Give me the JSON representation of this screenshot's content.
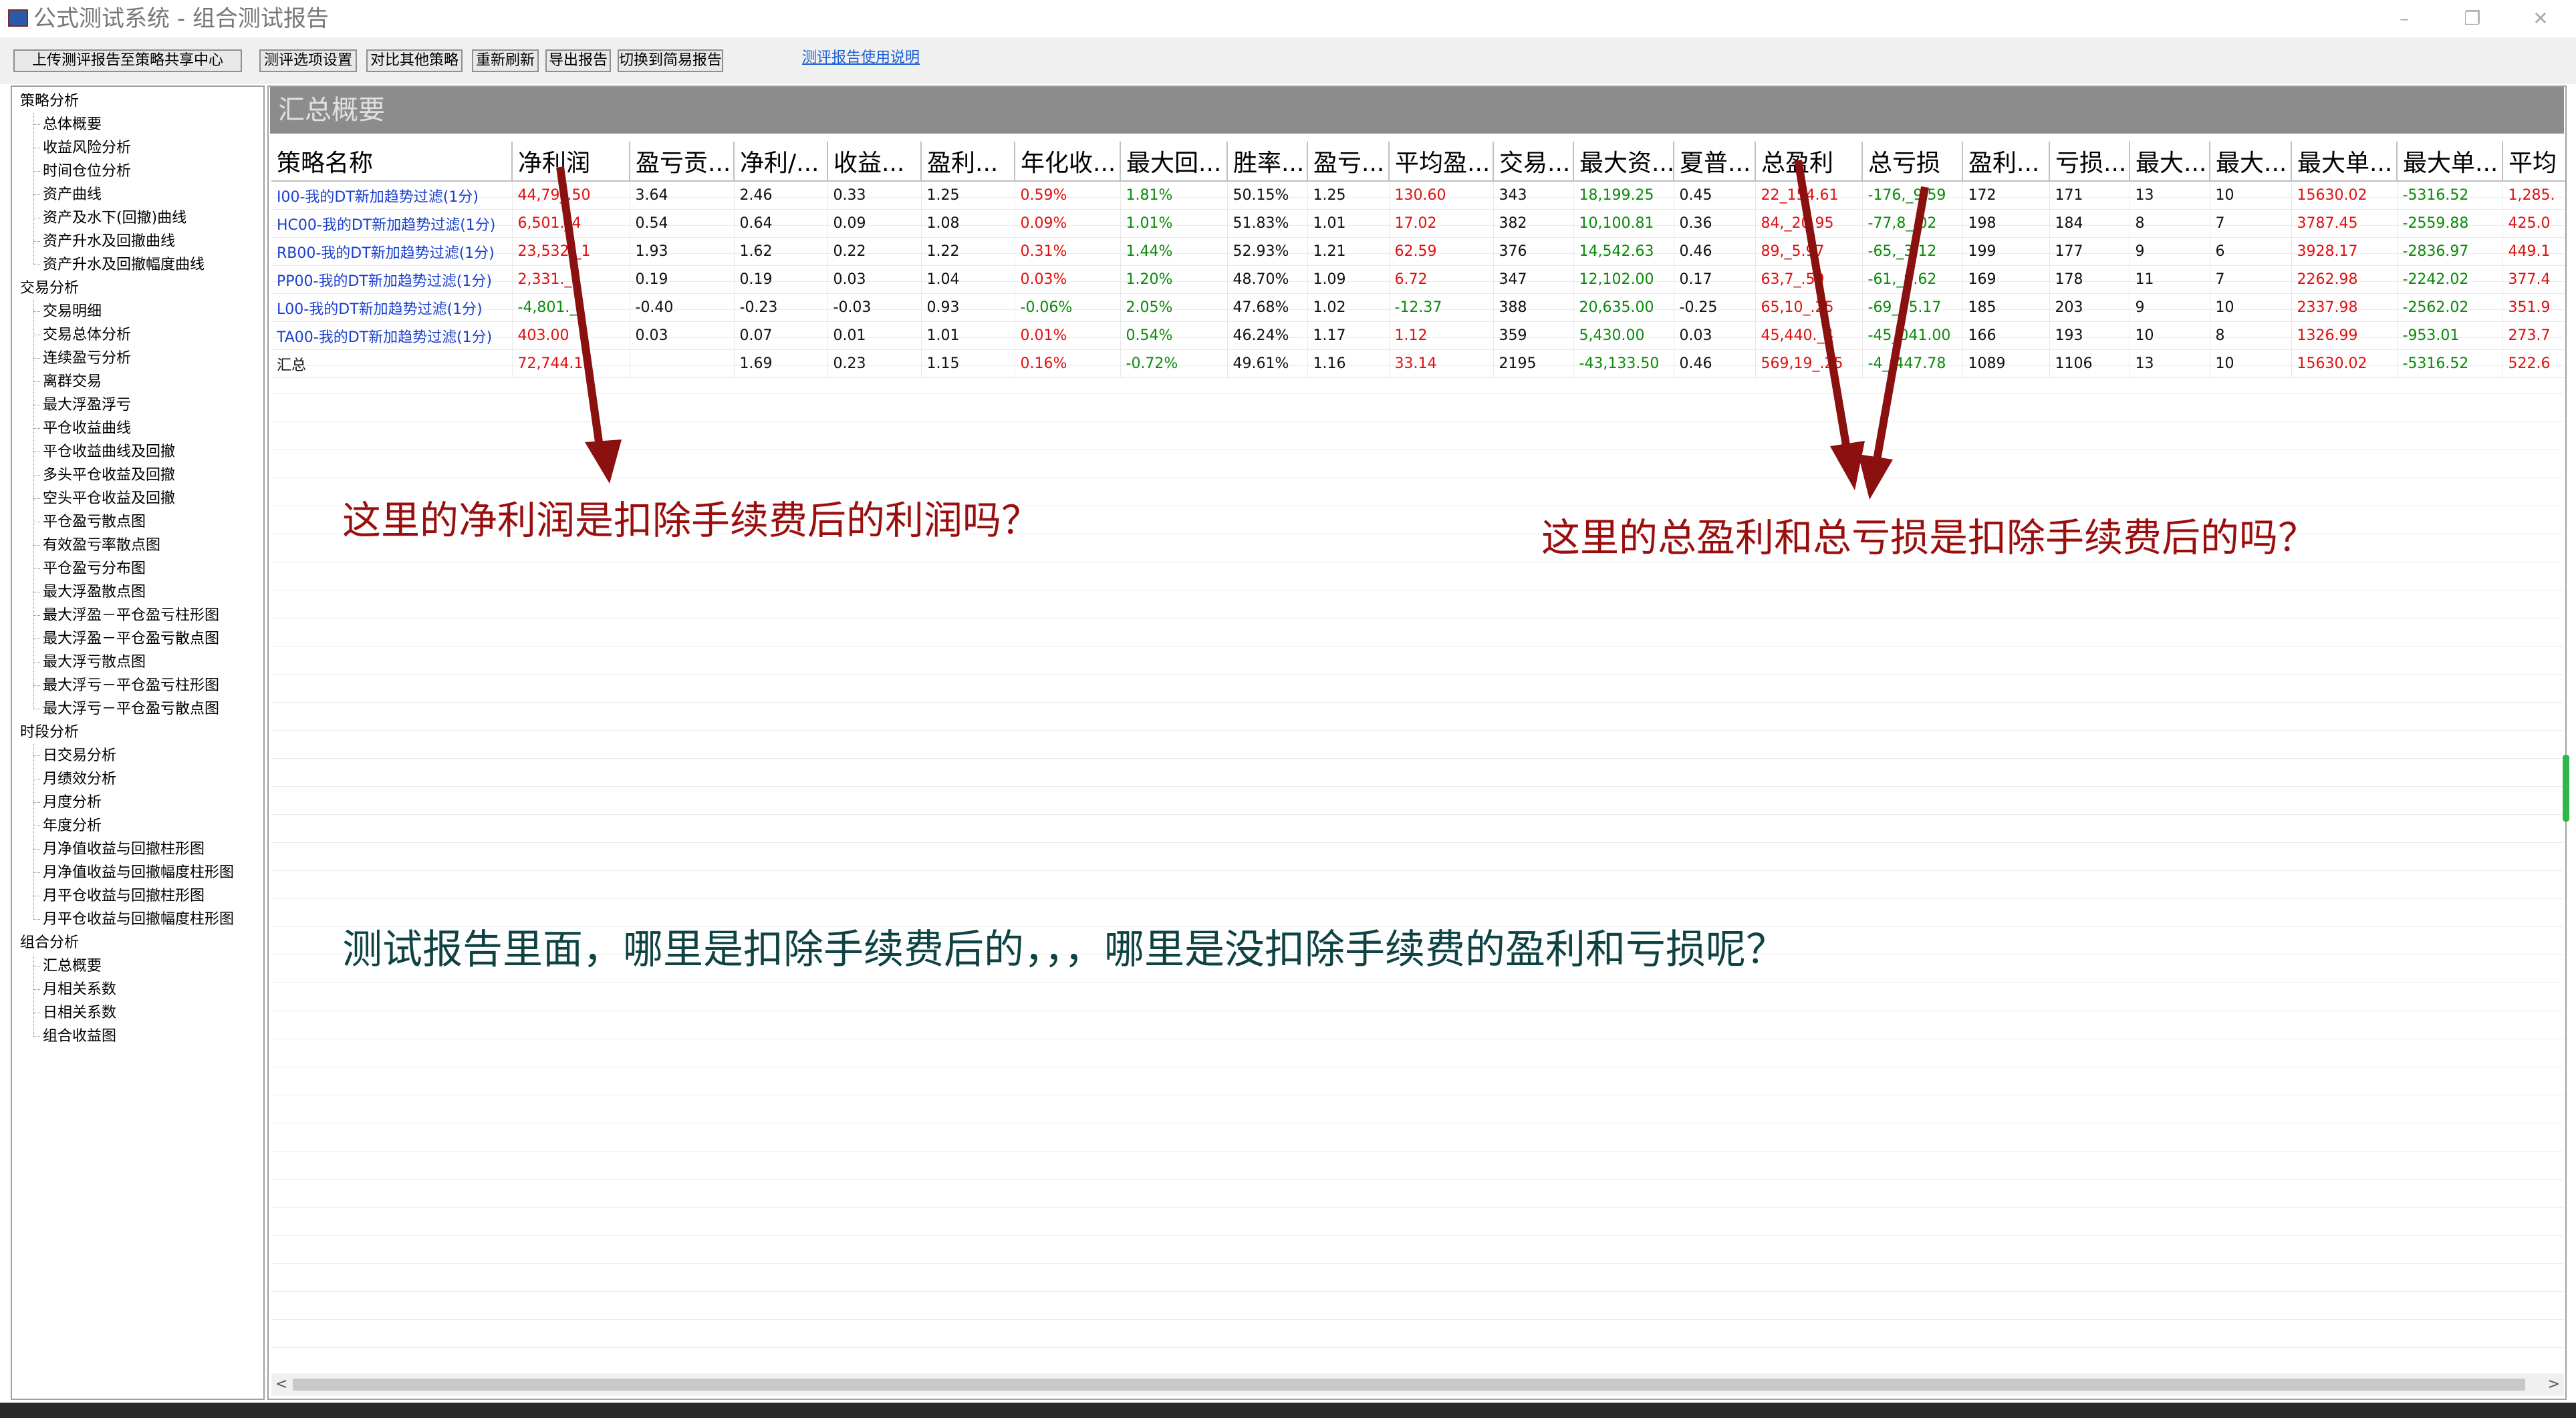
{
  "window": {
    "title": "公式测试系统 - 组合测试报告",
    "controls": [
      "–",
      "❐",
      "✕"
    ]
  },
  "toolbar": {
    "buttons": [
      "上传测评报告至策略共享中心",
      "测评选项设置",
      "对比其他策略",
      "重新刷新",
      "导出报告",
      "切换到简易报告"
    ],
    "help_link": "测评报告使用说明"
  },
  "sidebar": {
    "groups": [
      {
        "label": "策略分析",
        "items": [
          "总体概要",
          "收益风险分析",
          "时间仓位分析",
          "资产曲线",
          "资产及水下(回撤)曲线",
          "资产升水及回撤曲线",
          "资产升水及回撤幅度曲线"
        ]
      },
      {
        "label": "交易分析",
        "items": [
          "交易明细",
          "交易总体分析",
          "连续盈亏分析",
          "离群交易",
          "最大浮盈浮亏",
          "平仓收益曲线",
          "平仓收益曲线及回撤",
          "多头平仓收益及回撤",
          "空头平仓收益及回撤",
          "平仓盈亏散点图",
          "有效盈亏率散点图",
          "平仓盈亏分布图",
          "最大浮盈散点图",
          "最大浮盈－平仓盈亏柱形图",
          "最大浮盈－平仓盈亏散点图",
          "最大浮亏散点图",
          "最大浮亏－平仓盈亏柱形图",
          "最大浮亏－平仓盈亏散点图"
        ]
      },
      {
        "label": "时段分析",
        "items": [
          "日交易分析",
          "月绩效分析",
          "月度分析",
          "年度分析",
          "月净值收益与回撤柱形图",
          "月净值收益与回撤幅度柱形图",
          "月平仓收益与回撤柱形图",
          "月平仓收益与回撤幅度柱形图"
        ]
      },
      {
        "label": "组合分析",
        "items": [
          "汇总概要",
          "月相关系数",
          "日相关系数",
          "组合收益图"
        ]
      }
    ]
  },
  "section": {
    "title": "汇总概要"
  },
  "table": {
    "headers": [
      "策略名称",
      "净利润",
      "盈亏贡...",
      "净利/...",
      "收益...",
      "盈利...",
      "年化收...",
      "最大回...",
      "胜率...",
      "盈亏...",
      "平均盈...",
      "交易...",
      "最大资...",
      "夏普...",
      "总盈利",
      "总亏损",
      "盈利...",
      "亏损...",
      "最大...",
      "最大...",
      "最大单...",
      "最大单...",
      "平均"
    ],
    "rows": [
      {
        "cells": [
          "I00-我的DT新加趋势过滤(1分)",
          "44,79_.50",
          "3.64",
          "2.46",
          "0.33",
          "1.25",
          "0.59%",
          "1.81%",
          "50.15%",
          "1.25",
          "130.60",
          "343",
          "18,199.25",
          "0.45",
          "22_154.61",
          "-176,_9.59",
          "172",
          "171",
          "13",
          "10",
          "15630.02",
          "-5316.52",
          "1,285."
        ],
        "colors": [
          "blue",
          "red",
          "black",
          "black",
          "black",
          "black",
          "red",
          "green",
          "black",
          "black",
          "red",
          "black",
          "green",
          "black",
          "red",
          "green",
          "black",
          "black",
          "black",
          "black",
          "red",
          "green",
          "red"
        ]
      },
      {
        "cells": [
          "HC00-我的DT新加趋势过滤(1分)",
          "6,501._4",
          "0.54",
          "0.64",
          "0.09",
          "1.08",
          "0.09%",
          "1.01%",
          "51.83%",
          "1.01",
          "17.02",
          "382",
          "10,100.81",
          "0.36",
          "84,_20.95",
          "-77,8_.02",
          "198",
          "184",
          "8",
          "7",
          "3787.45",
          "-2559.88",
          "425.0"
        ],
        "colors": [
          "blue",
          "red",
          "black",
          "black",
          "black",
          "black",
          "red",
          "green",
          "black",
          "black",
          "red",
          "black",
          "green",
          "black",
          "red",
          "green",
          "black",
          "black",
          "black",
          "black",
          "red",
          "green",
          "red"
        ]
      },
      {
        "cells": [
          "RB00-我的DT新加趋势过滤(1分)",
          "23,532._1",
          "1.93",
          "1.62",
          "0.22",
          "1.22",
          "0.31%",
          "1.44%",
          "52.93%",
          "1.21",
          "62.59",
          "376",
          "14,542.63",
          "0.46",
          "89,_5.97",
          "-65,_3.12",
          "199",
          "177",
          "9",
          "6",
          "3928.17",
          "-2836.97",
          "449.1"
        ],
        "colors": [
          "blue",
          "red",
          "black",
          "black",
          "black",
          "black",
          "red",
          "green",
          "black",
          "black",
          "red",
          "black",
          "green",
          "black",
          "red",
          "green",
          "black",
          "black",
          "black",
          "black",
          "red",
          "green",
          "red"
        ]
      },
      {
        "cells": [
          "PP00-我的DT新加趋势过滤(1分)",
          "2,331._",
          "0.19",
          "0.19",
          "0.03",
          "1.04",
          "0.03%",
          "1.20%",
          "48.70%",
          "1.09",
          "6.72",
          "347",
          "12,102.00",
          "0.17",
          "63,7_.59",
          "-61,_9.62",
          "169",
          "178",
          "11",
          "7",
          "2262.98",
          "-2242.02",
          "377.4"
        ],
        "colors": [
          "blue",
          "red",
          "black",
          "black",
          "black",
          "black",
          "red",
          "green",
          "black",
          "black",
          "red",
          "black",
          "green",
          "black",
          "red",
          "green",
          "black",
          "black",
          "black",
          "black",
          "red",
          "green",
          "red"
        ]
      },
      {
        "cells": [
          "L00-我的DT新加趋势过滤(1分)",
          "-4,801._",
          "-0.40",
          "-0.23",
          "-0.03",
          "0.93",
          "-0.06%",
          "2.05%",
          "47.68%",
          "1.02",
          "-12.37",
          "388",
          "20,635.00",
          "-0.25",
          "65,10_.25",
          "-69_15.17",
          "185",
          "203",
          "9",
          "10",
          "2337.98",
          "-2562.02",
          "351.9"
        ],
        "colors": [
          "blue",
          "green",
          "black",
          "black",
          "black",
          "black",
          "green",
          "green",
          "black",
          "black",
          "green",
          "black",
          "green",
          "black",
          "red",
          "green",
          "black",
          "black",
          "black",
          "black",
          "red",
          "green",
          "red"
        ]
      },
      {
        "cells": [
          "TA00-我的DT新加趋势过滤(1分)",
          "403.00",
          "0.03",
          "0.07",
          "0.01",
          "1.01",
          "0.01%",
          "0.54%",
          "46.24%",
          "1.17",
          "1.12",
          "359",
          "5,430.00",
          "0.03",
          "45,440._4",
          "-45_041.00",
          "166",
          "193",
          "10",
          "8",
          "1326.99",
          "-953.01",
          "273.7"
        ],
        "colors": [
          "blue",
          "red",
          "black",
          "black",
          "black",
          "black",
          "red",
          "green",
          "black",
          "black",
          "red",
          "black",
          "green",
          "black",
          "red",
          "green",
          "black",
          "black",
          "black",
          "black",
          "red",
          "green",
          "red"
        ]
      },
      {
        "cells": [
          "汇总",
          "72,744.1",
          "",
          "1.69",
          "0.23",
          "1.15",
          "0.16%",
          "-0.72%",
          "49.61%",
          "1.16",
          "33.14",
          "2195",
          "-43,133.50",
          "0.46",
          "569,19_.25",
          "-4_,447.78",
          "1089",
          "1106",
          "13",
          "10",
          "15630.02",
          "-5316.52",
          "522.6"
        ],
        "colors": [
          "black",
          "red",
          "black",
          "black",
          "black",
          "black",
          "red",
          "green",
          "black",
          "black",
          "red",
          "black",
          "green",
          "black",
          "red",
          "green",
          "black",
          "black",
          "black",
          "black",
          "red",
          "green",
          "red"
        ]
      }
    ]
  },
  "annotations": {
    "left": "这里的净利润是扣除手续费后的利润吗？",
    "right": "这里的总盈利和总亏损是扣除手续费后的吗？",
    "bottom": "测试报告里面，哪里是扣除手续费后的，，，哪里是没扣除手续费的盈利和亏损呢？",
    "arrow_color": "#8b1010"
  },
  "scrollbar": {
    "left": "<",
    "right": ">"
  }
}
